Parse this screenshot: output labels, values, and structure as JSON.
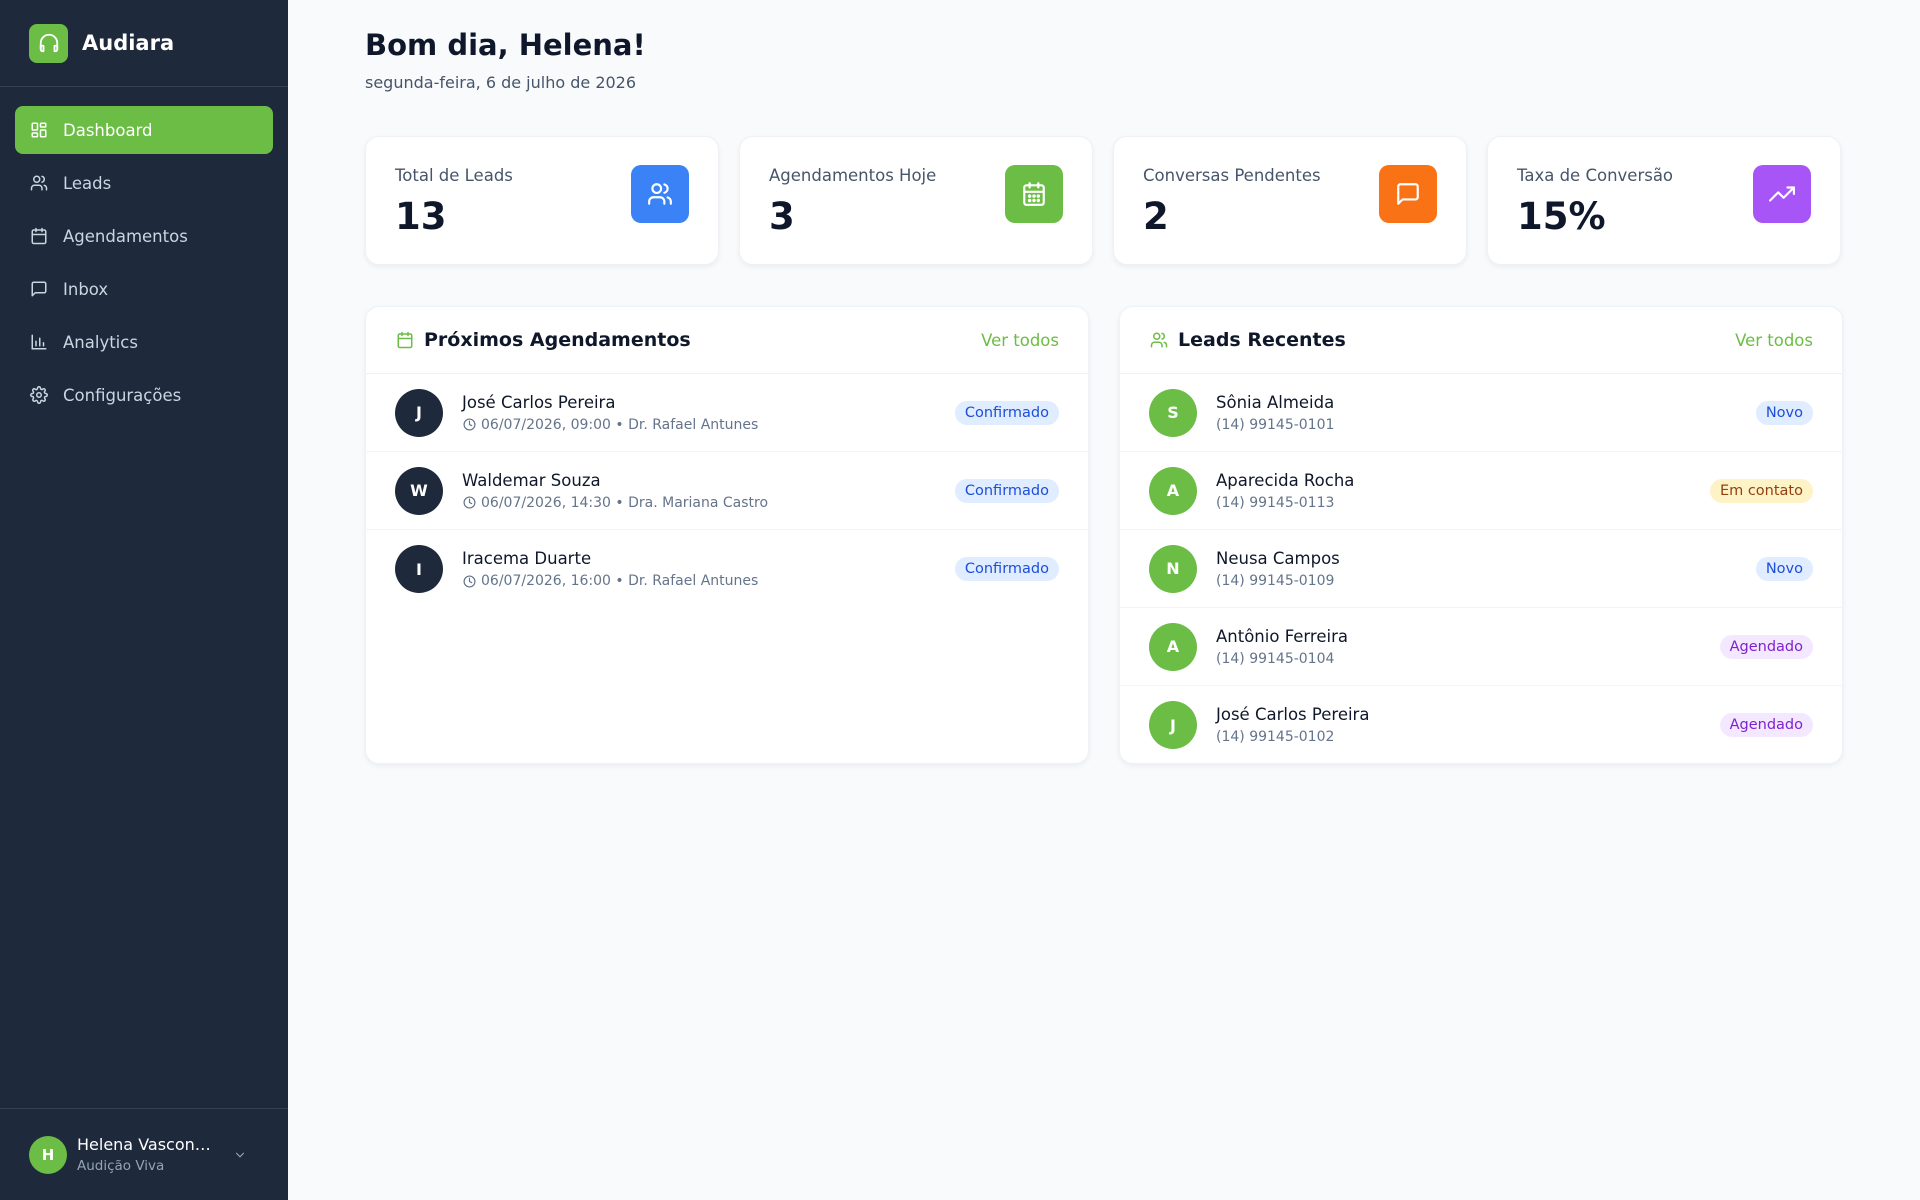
{
  "brand": {
    "name": "Audiara",
    "icon": "headphones-icon"
  },
  "sidebar": {
    "items": [
      {
        "label": "Dashboard",
        "icon": "dashboard-icon",
        "active": true
      },
      {
        "label": "Leads",
        "icon": "users-icon"
      },
      {
        "label": "Agendamentos",
        "icon": "calendar-icon"
      },
      {
        "label": "Inbox",
        "icon": "message-icon"
      },
      {
        "label": "Analytics",
        "icon": "bar-chart-icon"
      },
      {
        "label": "Configurações",
        "icon": "gear-icon"
      }
    ]
  },
  "user": {
    "initial": "H",
    "name": "Helena Vasconc...",
    "org": "Audição Viva"
  },
  "header": {
    "greeting": "Bom dia, Helena!",
    "date": "segunda-feira, 6 de julho de 2026"
  },
  "stats": [
    {
      "label": "Total de Leads",
      "value": "13",
      "icon": "users-icon",
      "color": "#3b82f6"
    },
    {
      "label": "Agendamentos Hoje",
      "value": "3",
      "icon": "calendar-icon",
      "color": "#6cbd45"
    },
    {
      "label": "Conversas Pendentes",
      "value": "2",
      "icon": "message-icon",
      "color": "#f97316"
    },
    {
      "label": "Taxa de Conversão",
      "value": "15%",
      "icon": "trending-up-icon",
      "color": "#a855f7"
    }
  ],
  "appointments": {
    "title": "Próximos Agendamentos",
    "view_all": "Ver todos",
    "items": [
      {
        "initial": "J",
        "name": "José Carlos Pereira",
        "detail": "06/07/2026, 09:00 • Dr. Rafael Antunes",
        "status": "Confirmado"
      },
      {
        "initial": "W",
        "name": "Waldemar Souza",
        "detail": "06/07/2026, 14:30 • Dra. Mariana Castro",
        "status": "Confirmado"
      },
      {
        "initial": "I",
        "name": "Iracema Duarte",
        "detail": "06/07/2026, 16:00 • Dr. Rafael Antunes",
        "status": "Confirmado"
      }
    ]
  },
  "leads": {
    "title": "Leads Recentes",
    "view_all": "Ver todos",
    "items": [
      {
        "initial": "S",
        "name": "Sônia Almeida",
        "phone": "(14) 99145-0101",
        "status": "Novo",
        "status_color": "blue"
      },
      {
        "initial": "A",
        "name": "Aparecida Rocha",
        "phone": "(14) 99145-0113",
        "status": "Em contato",
        "status_color": "yellow"
      },
      {
        "initial": "N",
        "name": "Neusa Campos",
        "phone": "(14) 99145-0109",
        "status": "Novo",
        "status_color": "blue"
      },
      {
        "initial": "A",
        "name": "Antônio Ferreira",
        "phone": "(14) 99145-0104",
        "status": "Agendado",
        "status_color": "purple"
      },
      {
        "initial": "J",
        "name": "José Carlos Pereira",
        "phone": "(14) 99145-0102",
        "status": "Agendado",
        "status_color": "purple"
      }
    ]
  }
}
